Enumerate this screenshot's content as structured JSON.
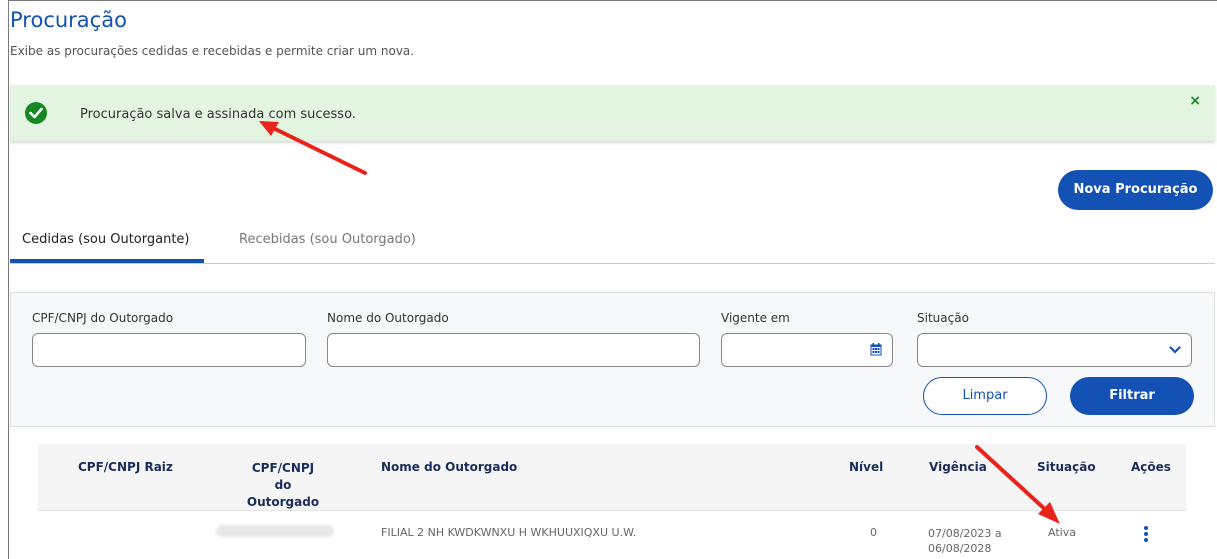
{
  "page": {
    "title": "Procuração",
    "subtitle": "Exibe as procurações cedidas e recebidas e permite criar um nova."
  },
  "alert": {
    "message": "Procuração salva e assinada com sucesso.",
    "close_glyph": "×",
    "icon": "check-circle-icon",
    "color": "#168821"
  },
  "actions": {
    "new_label": "Nova Procuração"
  },
  "tabs": [
    {
      "label": "Cedidas (sou Outorgante)",
      "active": true
    },
    {
      "label": "Recebidas (sou Outorgado)",
      "active": false
    }
  ],
  "filters": {
    "cpf_label": "CPF/CNPJ do Outorgado",
    "cpf_value": "",
    "nome_label": "Nome do Outorgado",
    "nome_value": "",
    "vigente_label": "Vigente em",
    "vigente_value": "",
    "situacao_label": "Situação",
    "situacao_value": "",
    "clear_label": "Limpar",
    "filter_label": "Filtrar"
  },
  "table": {
    "headers": [
      "CPF/CNPJ Raiz",
      "CPF/CNPJ do Outorgado",
      "Nome do Outorgado",
      "Nível",
      "Vigência",
      "Situação",
      "Ações"
    ],
    "rows": [
      {
        "cpf_raiz": "",
        "cpf_outorgado": "",
        "nome": "FILIAL 2 NH KWDKWNXU H WKHUUXIQXU U.W.",
        "nivel": "0",
        "vigencia_start": "07/08/2023 a",
        "vigencia_end": "06/08/2028",
        "situacao": "Ativa"
      }
    ]
  },
  "colors": {
    "primary": "#1351b4",
    "success_bg": "#e3f5e1",
    "annotation_arrow": "#e8231b"
  }
}
